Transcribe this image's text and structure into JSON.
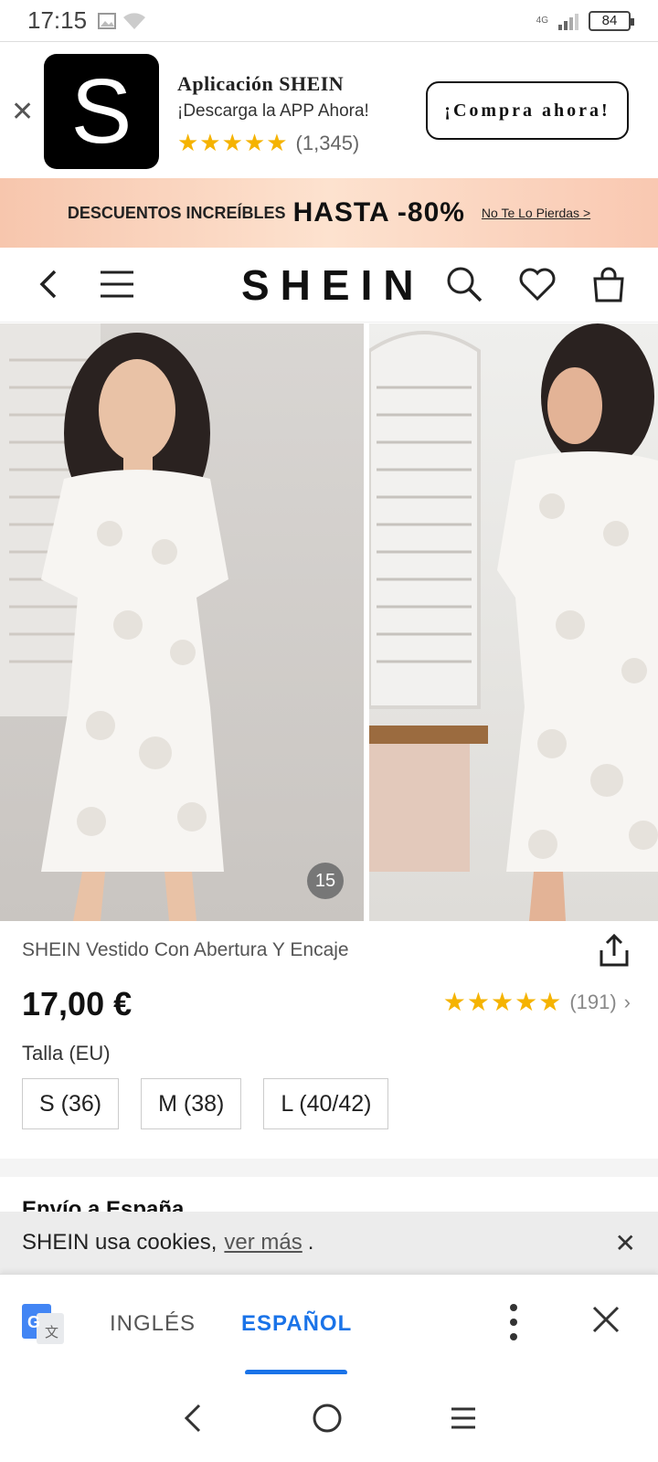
{
  "status": {
    "time": "17:15",
    "net": "4G",
    "battery": "84"
  },
  "app_banner": {
    "logo_letter": "S",
    "title": "Aplicación SHEIN",
    "subtitle": "¡Descarga la APP Ahora!",
    "stars": "★★★★★",
    "reviews": "(1,345)",
    "cta": "¡Compra ahora!"
  },
  "promo": {
    "lead": "DESCUENTOS INCREÍBLES",
    "highlight": "HASTA -80%",
    "link": "No Te Lo Pierdas >"
  },
  "nav": {
    "brand": "SHEIN"
  },
  "gallery": {
    "counter": "15"
  },
  "product": {
    "name": "SHEIN Vestido Con Abertura Y Encaje",
    "price": "17,00 €",
    "rating_stars": "★★★★★",
    "rating_count": "(191)",
    "size_label": "Talla (EU)",
    "sizes": [
      "S (36)",
      "M (38)",
      "L (40/42)"
    ]
  },
  "shipping": {
    "title": "Envío a España"
  },
  "cookie": {
    "text": "SHEIN usa cookies,",
    "link": "ver más",
    "tail": "."
  },
  "translate_bar": {
    "lang_from": "INGLÉS",
    "lang_to": "ESPAÑOL"
  },
  "colors": {
    "accent": "#1a73e8",
    "star": "#f5b301"
  }
}
